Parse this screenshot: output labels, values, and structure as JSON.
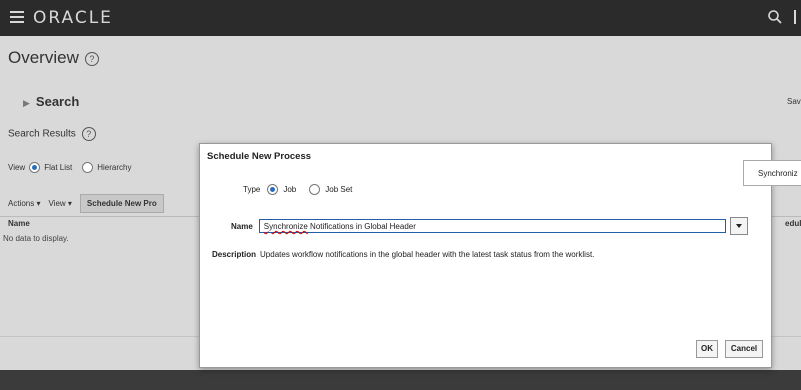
{
  "app": {
    "brand": "ORACLE"
  },
  "page": {
    "title": "Overview",
    "help_glyph": "?"
  },
  "search": {
    "label": "Search",
    "saved_label": "Sav"
  },
  "results": {
    "title": "Search Results",
    "view_label": "View",
    "view_options": [
      "Flat List",
      "Hierarchy"
    ],
    "selected_view": "Flat List",
    "toolbar": {
      "actions": "Actions ▾",
      "view": "View ▾",
      "schedule": "Schedule New Pro"
    },
    "columns": {
      "name": "Name",
      "scheduled": "eduled"
    },
    "empty_text": "No data to display."
  },
  "dialog": {
    "title": "Schedule New Process",
    "type_label": "Type",
    "type_options": [
      "Job",
      "Job Set"
    ],
    "selected_type": "Job",
    "name_label": "Name",
    "name_value_word": "Synchronize",
    "name_value_rest": " Notifications in Global Header",
    "description_label": "Description",
    "description_value": "Updates workflow notifications in the global header with the latest task status from the worklist.",
    "ok_label": "OK",
    "cancel_label": "Cancel"
  },
  "tooltip": {
    "text": "Synchroniz"
  },
  "colors": {
    "topbar": "#2b2b2b",
    "accent": "#2a6db8",
    "input_border": "#1f5fa8"
  }
}
